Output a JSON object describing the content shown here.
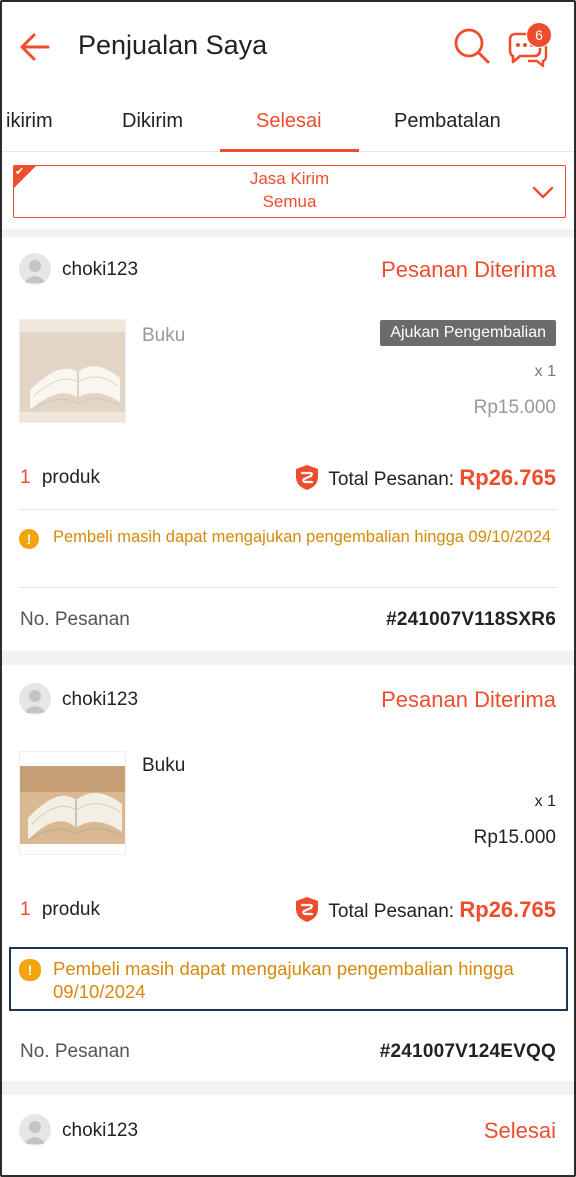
{
  "header": {
    "title": "Penjualan Saya",
    "chat_badge": "6"
  },
  "tabs": [
    {
      "label": "ikirim",
      "active": false
    },
    {
      "label": "Dikirim",
      "active": false
    },
    {
      "label": "Selesai",
      "active": true
    },
    {
      "label": "Pembatalan",
      "active": false
    }
  ],
  "filter": {
    "label": "Jasa Kirim",
    "value": "Semua"
  },
  "orders": [
    {
      "buyer": "choki123",
      "status": "Pesanan Diterima",
      "product_name": "Buku",
      "return_button": "Ajukan Pengembalian",
      "quantity": "x 1",
      "price": "Rp15.000",
      "product_count": "1",
      "product_count_label": "produk",
      "total_label": "Total Pesanan:",
      "total_value": "Rp26.765",
      "notice": "Pembeli masih dapat mengajukan pengembalian hingga 09/10/2024",
      "order_label": "No. Pesanan",
      "order_number": "#241007V118SXR6"
    },
    {
      "buyer": "choki123",
      "status": "Pesanan Diterima",
      "product_name": "Buku",
      "quantity": "x 1",
      "price": "Rp15.000",
      "product_count": "1",
      "product_count_label": "produk",
      "total_label": "Total Pesanan:",
      "total_value": "Rp26.765",
      "notice": "Pembeli masih dapat mengajukan pengembalian hingga 09/10/2024",
      "order_label": "No. Pesanan",
      "order_number": "#241007V124EVQQ"
    },
    {
      "buyer": "choki123",
      "status": "Selesai"
    }
  ],
  "colors": {
    "accent": "#ee4d2d",
    "warning": "#d6890a",
    "highlight_border": "#1c3550"
  }
}
